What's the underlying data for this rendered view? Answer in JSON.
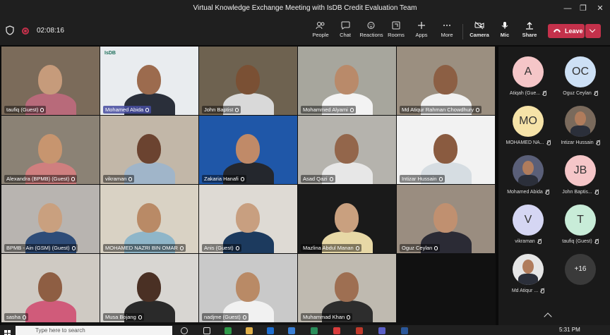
{
  "window": {
    "title": "Virtual Knowledge Exchange Meeting with IsDB Credit Evaluation Team"
  },
  "toolbar": {
    "timer": "02:08:16",
    "buttons": [
      {
        "label": "People",
        "icon": "people-icon"
      },
      {
        "label": "Chat",
        "icon": "chat-icon"
      },
      {
        "label": "Reactions",
        "icon": "reactions-icon"
      },
      {
        "label": "Rooms",
        "icon": "rooms-icon"
      },
      {
        "label": "Apps",
        "icon": "apps-icon"
      },
      {
        "label": "More",
        "icon": "more-icon"
      },
      {
        "label": "Camera",
        "icon": "camera-icon"
      },
      {
        "label": "Mic",
        "icon": "mic-icon"
      },
      {
        "label": "Share",
        "icon": "share-icon"
      }
    ],
    "leave_label": "Leave"
  },
  "gallery": [
    {
      "name": "taufiq (Guest)",
      "bg": "#7b6b5a",
      "skin": "#c69b7b",
      "shirt": "#b86a7a"
    },
    {
      "name": "Mohamed Abida",
      "bg": "#e9ecef",
      "skin": "#9c6b4e",
      "shirt": "#2a2f3a",
      "highlight": true,
      "logo": "IsDB"
    },
    {
      "name": "John Baptist",
      "bg": "#6e6250",
      "skin": "#7a5034",
      "shirt": "#d9d9d9"
    },
    {
      "name": "Mohammed Alyami",
      "bg": "#a7a69d",
      "skin": "#b98a6a",
      "shirt": "#f3f3f3"
    },
    {
      "name": "Md Atiqur Rahman Chowdhury",
      "bg": "#9b8f80",
      "skin": "#8c5f44",
      "shirt": "#f1f1f1"
    },
    {
      "name": "Alexandra (BPMB) (Guest)",
      "bg": "#8b8275",
      "skin": "#c7956f",
      "shirt": "#cf7f7f"
    },
    {
      "name": "vikraman",
      "bg": "#c2b7a8",
      "skin": "#6b4330",
      "shirt": "#a0b5c9"
    },
    {
      "name": "Zakaria Hanafi",
      "bg": "#1f57a8",
      "skin": "#c08a68",
      "shirt": "#24272d"
    },
    {
      "name": "Asad Qazi",
      "bg": "#b5b3ad",
      "skin": "#93664b",
      "shirt": "#e7e7e7"
    },
    {
      "name": "Intizar Hussain",
      "bg": "#f2f2f2",
      "skin": "#8a5b40",
      "shirt": "#d6dde2"
    },
    {
      "name": "BPMB - Ain (GSM) (Guest)",
      "bg": "#b8b4b0",
      "skin": "#c9a07f",
      "shirt": "#2e4c78"
    },
    {
      "name": "MOHAMED NAZRI BIN OMAR",
      "bg": "#d9d2c4",
      "skin": "#b98a66",
      "shirt": "#8fb6c9"
    },
    {
      "name": "Anis (Guest)",
      "bg": "#dedad4",
      "skin": "#c89f80",
      "shirt": "#1c3a5e"
    },
    {
      "name": "Mazlina Abdul Manan",
      "bg": "#1a1a1a",
      "skin": "#c9a07f",
      "shirt": "#e7d8a6"
    },
    {
      "name": "Oguz Ceylan",
      "bg": "#9a8d80",
      "skin": "#c09070",
      "shirt": "#2b2b35"
    },
    {
      "name": "sasha",
      "bg": "#cfcac3",
      "skin": "#8e5e43",
      "shirt": "#d05b7a"
    },
    {
      "name": "Musa Bojang",
      "bg": "#d8d6d2",
      "skin": "#4a3024",
      "shirt": "#2a2a2a"
    },
    {
      "name": "nadjme (Guest)",
      "bg": "#c9c9c9",
      "skin": "#b98a66",
      "shirt": "#f1f1f1"
    },
    {
      "name": "Muhammad Khan",
      "bg": "#bfbab0",
      "skin": "#9e6f52",
      "shirt": "#2d2d2d"
    }
  ],
  "roster": [
    {
      "name": "Atiqah (Gue...",
      "initials": "A",
      "color": "#f5c6c8"
    },
    {
      "name": "Oguz Ceylan",
      "initials": "OC",
      "color": "#cde0f5"
    },
    {
      "name": "MOHAMED NA...",
      "initials": "MO",
      "color": "#f6e3a8"
    },
    {
      "name": "Intizar Hussain",
      "initials": "",
      "color": "#7a6a5c"
    },
    {
      "name": "Mohamed Abida",
      "initials": "",
      "color": "#5a5f78"
    },
    {
      "name": "John Baptis...",
      "initials": "JB",
      "color": "#f5c6c8"
    },
    {
      "name": "vikraman",
      "initials": "V",
      "color": "#d5d6f3"
    },
    {
      "name": "taufiq (Guest)",
      "initials": "T",
      "color": "#c8ecd8"
    },
    {
      "name": "Md Atiqur ...",
      "initials": "",
      "color": "#e6e6e6"
    }
  ],
  "roster_more": "+16",
  "taskbar": {
    "search_placeholder": "Type here to search",
    "time": "5:31 PM"
  }
}
